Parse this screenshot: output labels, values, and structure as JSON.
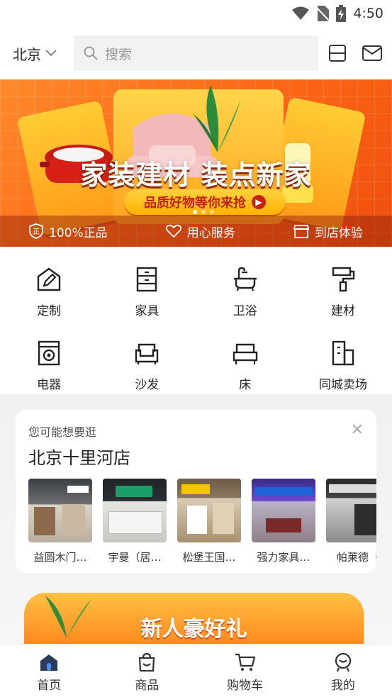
{
  "status": {
    "time": "4:50"
  },
  "topbar": {
    "city": "北京",
    "search_placeholder": "搜索"
  },
  "banner": {
    "headline": "家装建材 装点新家",
    "sub": "品质好物等你来抢",
    "guarantees": [
      "100%正品",
      "用心服务",
      "到店体验"
    ]
  },
  "categories": [
    {
      "label": "定制",
      "icon": "pencil-house-icon"
    },
    {
      "label": "家具",
      "icon": "cabinet-icon"
    },
    {
      "label": "卫浴",
      "icon": "bathtub-icon"
    },
    {
      "label": "建材",
      "icon": "paint-roller-icon"
    },
    {
      "label": "电器",
      "icon": "washing-machine-icon"
    },
    {
      "label": "沙发",
      "icon": "sofa-icon"
    },
    {
      "label": "床",
      "icon": "bed-icon"
    },
    {
      "label": "同城卖场",
      "icon": "building-icon"
    }
  ],
  "recommend": {
    "hint": "您可能想要逛",
    "store": "北京十里河店",
    "items": [
      {
        "label": "益圆木门…"
      },
      {
        "label": "宇曼（居…"
      },
      {
        "label": "松堡王国…"
      },
      {
        "label": "强力家具…"
      },
      {
        "label": "帕莱德（"
      }
    ]
  },
  "promo": {
    "title": "新人豪好礼"
  },
  "tabs": [
    {
      "label": "首页",
      "icon": "home-icon"
    },
    {
      "label": "商品",
      "icon": "bag-icon"
    },
    {
      "label": "购物车",
      "icon": "cart-icon"
    },
    {
      "label": "我的",
      "icon": "profile-icon"
    }
  ],
  "colors": {
    "accent": "#ff6a16",
    "active_tab": "#2a3b5c"
  }
}
